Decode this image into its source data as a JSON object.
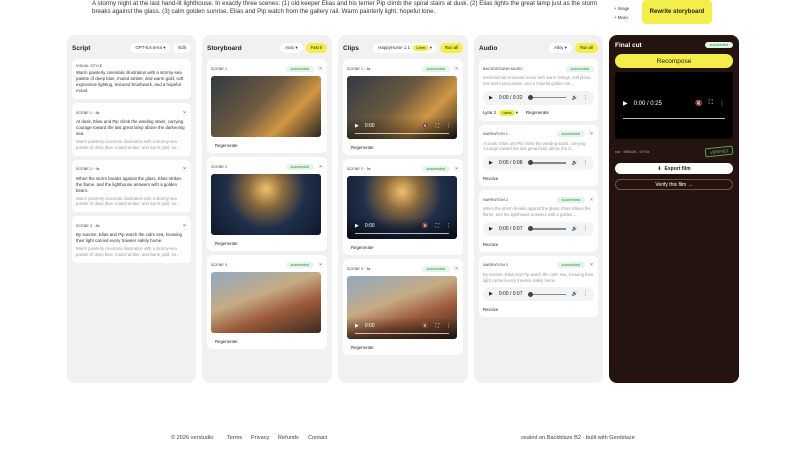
{
  "prompt": {
    "text": "A stormy night at the last hand-lit lighthouse. In exactly three scenes: (1) old keeper Elias and his terrier Pip climb the spiral stairs at dusk. (2) Elias lights the great lamp just as the storm breaks against the glass. (3) calm golden sunrise. Elias and Pip watch from the gallery rail. Warm painterly light, hopeful tone.",
    "add_image": "+ Image",
    "add_music": "+ Music",
    "rewrite": "Rewrite storyboard"
  },
  "script": {
    "title": "Script",
    "model": "GPT-5.6 terra",
    "edit": "Edit",
    "visual_style": {
      "label": "VISUAL STYLE",
      "text": "Warm painterly cinematic illustration with a stormy-sea palette of deep blue, muted amber, and warm gold, soft expressive lighting, textured brushwork, and a hopeful mood."
    },
    "scenes": [
      {
        "label": "SCENE 1 · 8s",
        "text": "At dusk, Elias and Pip climb the winding stairs, carrying courage toward the last great lamp above the darkening sea.",
        "style": "Warm painterly cinematic illustration with a stormy-sea palette of deep blue, muted amber, and warm gold, so..."
      },
      {
        "label": "SCENE 2 · 9s",
        "text": "When the storm breaks against the glass, Elias strikes the flame, and the lighthouse answers with a golden beam.",
        "style": "Warm painterly cinematic illustration with a stormy-sea palette of deep blue, muted amber, and warm gold, so..."
      },
      {
        "label": "SCENE 3 · 8s",
        "text": "By sunrise, Elias and Pip watch the calm sea, knowing their light carried every traveler safely home.",
        "style": "Warm painterly cinematic illustration with a stormy-sea palette of deep blue, muted amber, and warm gold, so..."
      }
    ]
  },
  "storyboard": {
    "title": "Storyboard",
    "mode": "Auto",
    "action": "Fast it",
    "scenes": [
      {
        "label": "SCENE 1",
        "status": "succeeded",
        "regen": "Regenerate"
      },
      {
        "label": "SCENE 2",
        "status": "succeeded",
        "regen": "Regenerate"
      },
      {
        "label": "SCENE 3",
        "status": "succeeded",
        "regen": "Regenerate"
      }
    ]
  },
  "clips": {
    "title": "Clips",
    "model": "HappyHorse 1.1",
    "model_tag": "Latest",
    "run_all": "Run all",
    "items": [
      {
        "label": "SCENE 1 · 8s",
        "status": "succeeded",
        "time": "0:00",
        "regen": "Regenerate"
      },
      {
        "label": "SCENE 2 · 9s",
        "status": "succeeded",
        "time": "0:00",
        "regen": "Regenerate"
      },
      {
        "label": "SCENE 3 · 8s",
        "status": "succeeded",
        "time": "0:00",
        "regen": "Regenerate"
      }
    ]
  },
  "audio": {
    "title": "Audio",
    "model": "Alloy",
    "run_all": "Run all",
    "music": {
      "label": "BACKGROUND MUSIC",
      "status": "succeeded",
      "text": "Instrumental cinematic score with warm strings, soft piano, low storm percussion, and a hopeful golden sw...",
      "time": "0:00 / 0:32",
      "voice": "Lyria 2",
      "voice_tag": "Latest",
      "regen": "Regenerate"
    },
    "narrations": [
      {
        "label": "NARRATION 1",
        "status": "succeeded",
        "text": "At dusk, Elias and Pip climb the winding stairs, carrying courage toward the last great lamp above the d...",
        "time": "0:00 / 0:08",
        "revoice": "Revoice"
      },
      {
        "label": "NARRATION 2",
        "status": "succeeded",
        "text": "When the storm breaks against the glass, Elias strikes the flame, and the lighthouse answers with a golden...",
        "time": "0:00 / 0:07",
        "revoice": "Revoice"
      },
      {
        "label": "NARRATION 3",
        "status": "succeeded",
        "text": "By sunrise, Elias and Pip watch the calm sea, knowing their light carried every traveler safely home.",
        "time": "0:00 / 0:07",
        "revoice": "Revoice"
      }
    ]
  },
  "final": {
    "title": "Final cut",
    "status": "succeeded",
    "recompose": "Recompose",
    "time": "0:00 / 0:25",
    "signature": "sha · 4f9b8d2e…0e77fa",
    "verified": "VERIFIED",
    "export": "Export film",
    "verify": "Verify this film →"
  },
  "footer": {
    "copyright": "© 2026 verstudio",
    "terms": "Terms",
    "privacy": "Privacy",
    "refunds": "Refunds",
    "contact": "Contact",
    "sealed": "sealed on Backblaze B2 · built with Gemblaze"
  }
}
